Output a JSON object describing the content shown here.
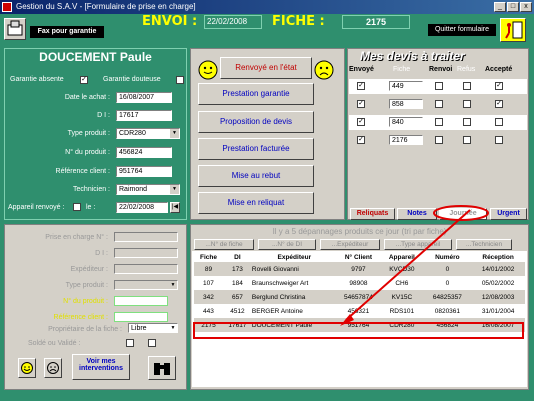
{
  "window": {
    "title": "Gestion du S.A.V - [Formulaire de prise en charge]"
  },
  "header": {
    "envoi_label": "ENVOI :",
    "envoi_date": "22/02/2008",
    "fiche_label": "FICHE :",
    "fiche_number": "2175",
    "fax_label": "Fax pour garantie",
    "quit_label": "Quitter formulaire"
  },
  "client": {
    "name": "DOUCEMENT   Paule",
    "garantie_absente": "Garantie absente",
    "garantie_douteuse": "Garantie douteuse",
    "date_achat_label": "Date le achat :",
    "date_achat": "16/08/2007",
    "di_label": "D I :",
    "di": "17617",
    "type_produit_label": "Type produit :",
    "type_produit": "CDR280",
    "no_produit_label": "N° du produit :",
    "no_produit": "456824",
    "ref_client_label": "Référence client :",
    "ref_client": "951764",
    "technicien_label": "Technicien :",
    "technicien": "Raimond",
    "appareil_renvoye_label": "Appareil renvoyé :",
    "le_label": "le :",
    "appareil_renvoye_date": "22/02/2008"
  },
  "actions": [
    "Renvoyé en l'état",
    "Prestation garantie",
    "Proposition de devis",
    "Prestation facturée",
    "Mise au  rebut",
    "Mise en reliquat"
  ],
  "devis": {
    "title": "Mes devis à traiter",
    "columns": [
      "Envoyé",
      "Fiche",
      "Renvoi",
      "Refus",
      "Accepté"
    ],
    "rows": [
      {
        "fiche": "449",
        "envoye": "✓",
        "renvoi": "",
        "refus": "",
        "accepte": "✓"
      },
      {
        "fiche": "858",
        "envoye": "✓",
        "renvoi": "",
        "refus": "",
        "accepte": "✓"
      },
      {
        "fiche": "840",
        "envoye": "✓",
        "renvoi": "",
        "refus": "",
        "accepte": ""
      },
      {
        "fiche": "2176",
        "envoye": "✓",
        "renvoi": "",
        "refus": "",
        "accepte": ""
      }
    ]
  },
  "tabs": [
    "Reliquats",
    "Notes",
    "Journée",
    "Urgent"
  ],
  "prise": {
    "prise_label": "Prise en charge N° :",
    "di_label": "D I :",
    "expediteur_label": "Expéditeur :",
    "type_label": "Type produit :",
    "no_label": "N° du produit :",
    "ref_label": "Référence client :",
    "proprietaire_label": "Propriétaire de la fiche :",
    "proprietaire_value": "Libre",
    "solde_label": "Soldé ou Validé :",
    "voir_label": "Voir mes interventions"
  },
  "depannages": {
    "title": "Il y a 5 dépannages produits ce jour (tri par fiche)",
    "sort_buttons": [
      "...N° de fiche",
      "...N° de DI",
      "...Expéditeur",
      "...Type appareil",
      "...Technicien"
    ],
    "columns": [
      "Fiche",
      "DI",
      "Expéditeur",
      "N° Client",
      "Appareil",
      "Numéro",
      "Réception"
    ],
    "rows": [
      [
        "89",
        "173",
        "Rovelli  Giovanni",
        "9797",
        "KVCD30",
        "0",
        "14/01/2002"
      ],
      [
        "107",
        "184",
        "Braunschweiger  Art",
        "98908",
        "CH6",
        "0",
        "05/02/2002"
      ],
      [
        "342",
        "657",
        "Berglund  Christina",
        "54657874",
        "KV15C",
        "64825357",
        "12/08/2003"
      ],
      [
        "443",
        "4512",
        "BERGER  Antoine",
        "456321",
        "RDS101",
        "0820361",
        "31/01/2004"
      ],
      [
        "2175",
        "17617",
        "DOUCEMENT  Paule",
        "951764",
        "CDR280",
        "456824",
        "16/08/2007"
      ]
    ]
  },
  "colors": {
    "form_bg": "#2f8f6e",
    "title_yellow": "#ffff00",
    "highlight_red": "#e00000"
  }
}
